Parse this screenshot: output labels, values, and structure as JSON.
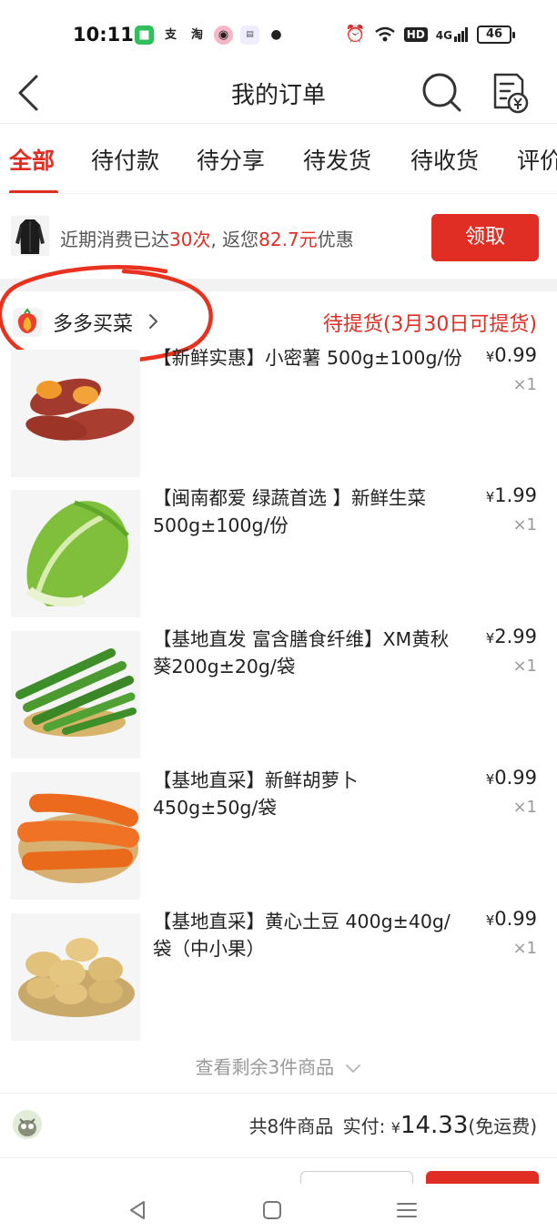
{
  "status_bar": {
    "time": "10:11",
    "hd_label": "HD",
    "network_label": "4G",
    "battery": "46"
  },
  "nav": {
    "title": "我的订单"
  },
  "tabs": [
    {
      "label": "全部",
      "active": true
    },
    {
      "label": "待付款"
    },
    {
      "label": "待分享"
    },
    {
      "label": "待发货"
    },
    {
      "label": "待收货"
    },
    {
      "label": "评价"
    }
  ],
  "promo": {
    "text_prefix": "近期消费已达",
    "count": "30次",
    "text_middle": ", 返您",
    "amount": "82.7元",
    "text_suffix": "优惠",
    "button_label": "领取"
  },
  "store": {
    "name": "多多买菜",
    "status": "待提货(3月30日可提货)"
  },
  "items": [
    {
      "title": "【新鲜实惠】小密薯 500g±100g/份",
      "price": "0.99",
      "qty": "×1",
      "thumb": "sweet-potato"
    },
    {
      "title": "【闽南都爱  绿蔬首选 】新鲜生菜500g±100g/份",
      "price": "1.99",
      "qty": "×1",
      "thumb": "lettuce"
    },
    {
      "title": "【基地直发 富含膳食纤维】XM黄秋葵200g±20g/袋",
      "price": "2.99",
      "qty": "×1",
      "thumb": "okra"
    },
    {
      "title": "【基地直采】新鲜胡萝卜 450g±50g/袋",
      "price": "0.99",
      "qty": "×1",
      "thumb": "carrot"
    },
    {
      "title": "【基地直采】黄心土豆 400g±40g/袋（中小果）",
      "price": "0.99",
      "qty": "×1",
      "thumb": "potato"
    }
  ],
  "currency": "¥",
  "view_more": "查看剩余3件商品",
  "summary": {
    "count_text": "共8件商品",
    "paid_label": "实付:",
    "amount": "14.33",
    "shipping": "(免运费)"
  },
  "colors": {
    "accent": "#e02e24",
    "annotation": "#e8321e"
  }
}
